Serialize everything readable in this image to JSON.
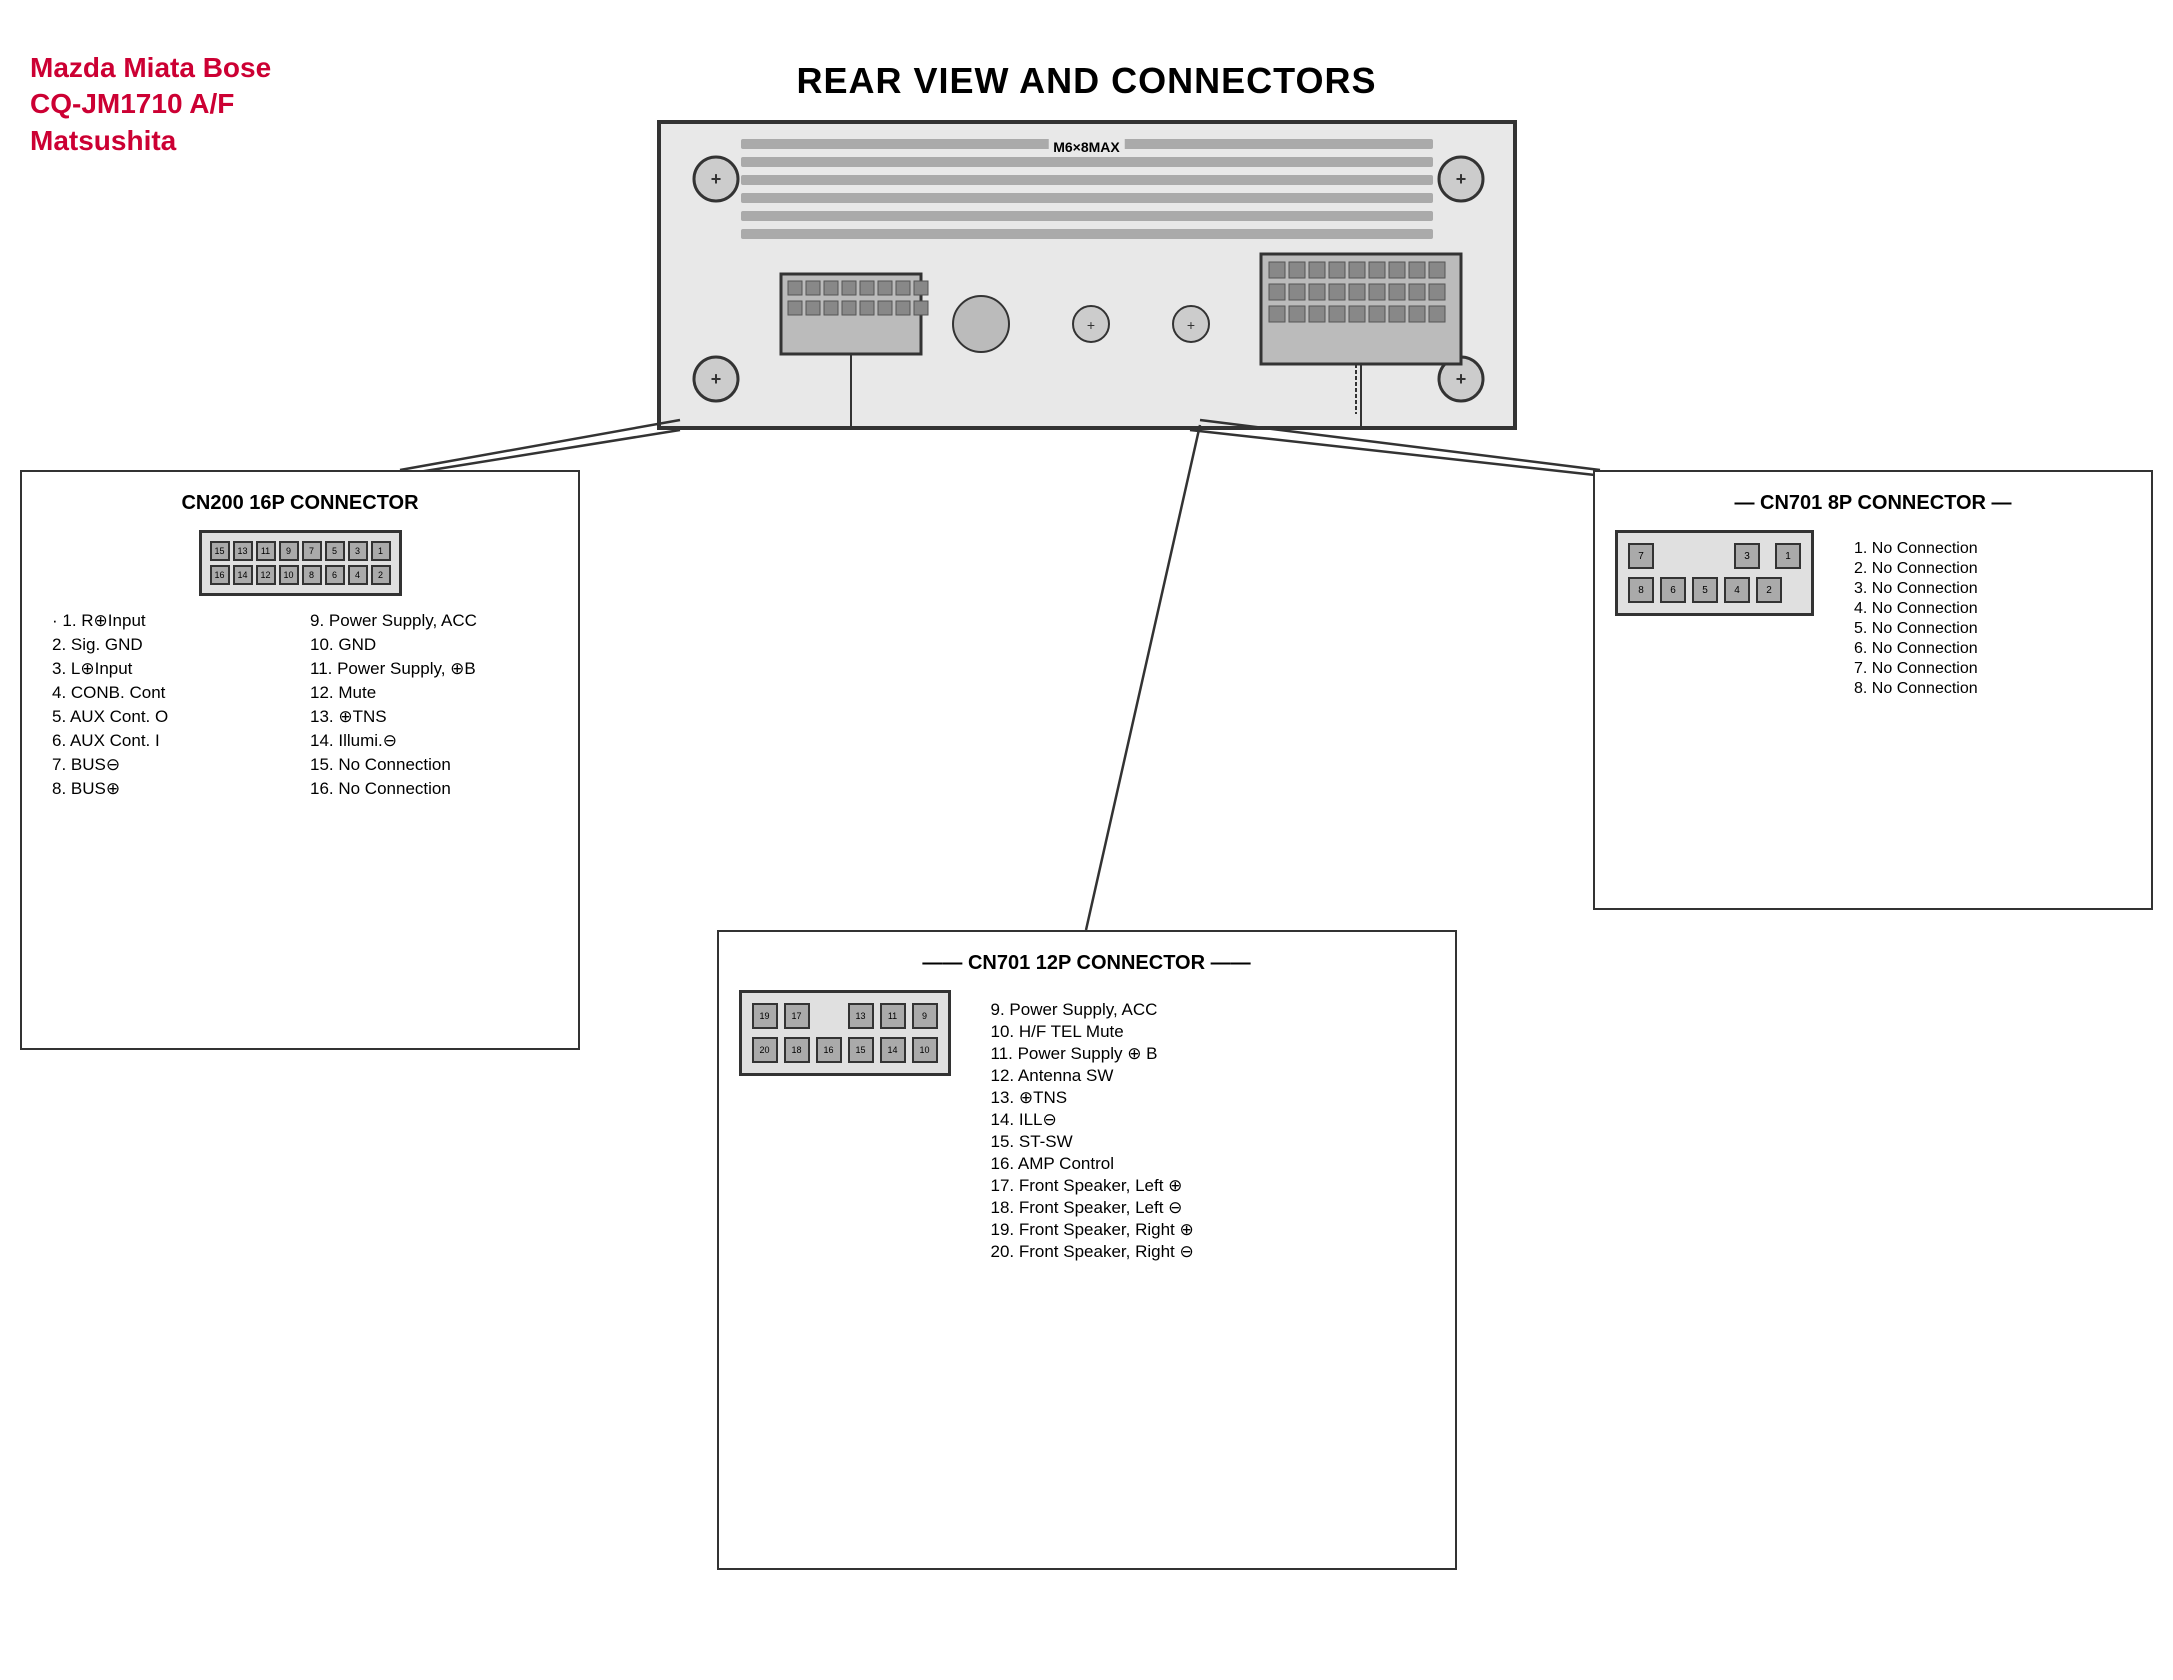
{
  "brand": {
    "line1": "Mazda Miata Bose",
    "line2": "CQ-JM1710 A/F",
    "line3": "Matsushita",
    "color": "#cc0033"
  },
  "page_title": "REAR VIEW AND CONNECTORS",
  "unit": {
    "label_m6": "M6×8MAX",
    "plus_symbol": "+"
  },
  "cn200": {
    "title": "CN200 16P CONNECTOR",
    "pins_row1": [
      "15",
      "13",
      "11",
      "9",
      "7",
      "5",
      "3",
      "1"
    ],
    "pins_row2": [
      "16",
      "14",
      "12",
      "10",
      "8",
      "6",
      "4",
      "2"
    ],
    "pin_list": [
      {
        "num": "1.",
        "label": "R⊕Input"
      },
      {
        "num": "9.",
        "label": "Power Supply, ACC"
      },
      {
        "num": "2.",
        "label": "Sig. GND"
      },
      {
        "num": "10.",
        "label": "GND"
      },
      {
        "num": "3.",
        "label": "L⊕Input"
      },
      {
        "num": "11.",
        "label": "Power Supply, ⊕B"
      },
      {
        "num": "4.",
        "label": "CONB. Cont"
      },
      {
        "num": "12.",
        "label": "Mute"
      },
      {
        "num": "5.",
        "label": "AUX Cont. O"
      },
      {
        "num": "13.",
        "label": "⊕TNS"
      },
      {
        "num": "6.",
        "label": "AUX Cont. I"
      },
      {
        "num": "14.",
        "label": "Illumi.⊖"
      },
      {
        "num": "7.",
        "label": "BUS⊖"
      },
      {
        "num": "15.",
        "label": "No Connection"
      },
      {
        "num": "8.",
        "label": "BUS⊕"
      },
      {
        "num": "16.",
        "label": "No Connection"
      }
    ]
  },
  "cn701_8p": {
    "title": "CN701 8P CONNECTOR",
    "pins_row1": [
      "7",
      "",
      "",
      "3",
      "1"
    ],
    "pins_row2": [
      "8",
      "6",
      "5",
      "4",
      "2"
    ],
    "pin_list": [
      {
        "num": "1.",
        "label": "No Connection"
      },
      {
        "num": "2.",
        "label": "No Connection"
      },
      {
        "num": "3.",
        "label": "No Connection"
      },
      {
        "num": "4.",
        "label": "No Connection"
      },
      {
        "num": "5.",
        "label": "No Connection"
      },
      {
        "num": "6.",
        "label": "No Connection"
      },
      {
        "num": "7.",
        "label": "No Connection"
      },
      {
        "num": "8.",
        "label": "No Connection"
      }
    ]
  },
  "cn701_12p": {
    "title": "CN701 12P CONNECTOR",
    "pins_row1": [
      "19",
      "17",
      "",
      "13",
      "11",
      "9"
    ],
    "pins_row2": [
      "20",
      "18",
      "16",
      "15",
      "14",
      "10"
    ],
    "pin_list": [
      {
        "num": "9.",
        "label": "Power Supply, ACC"
      },
      {
        "num": "10.",
        "label": "H/F TEL Mute"
      },
      {
        "num": "11.",
        "label": "Power Supply ⊕ B"
      },
      {
        "num": "12.",
        "label": "Antenna SW"
      },
      {
        "num": "13.",
        "label": "⊕TNS"
      },
      {
        "num": "14.",
        "label": "ILL⊖"
      },
      {
        "num": "15.",
        "label": "ST-SW"
      },
      {
        "num": "16.",
        "label": "AMP Control"
      },
      {
        "num": "17.",
        "label": "Front Speaker, Left ⊕"
      },
      {
        "num": "18.",
        "label": "Front Speaker, Left ⊖"
      },
      {
        "num": "19.",
        "label": "Front Speaker, Right ⊕"
      },
      {
        "num": "20.",
        "label": "Front Speaker, Right ⊖"
      }
    ]
  }
}
